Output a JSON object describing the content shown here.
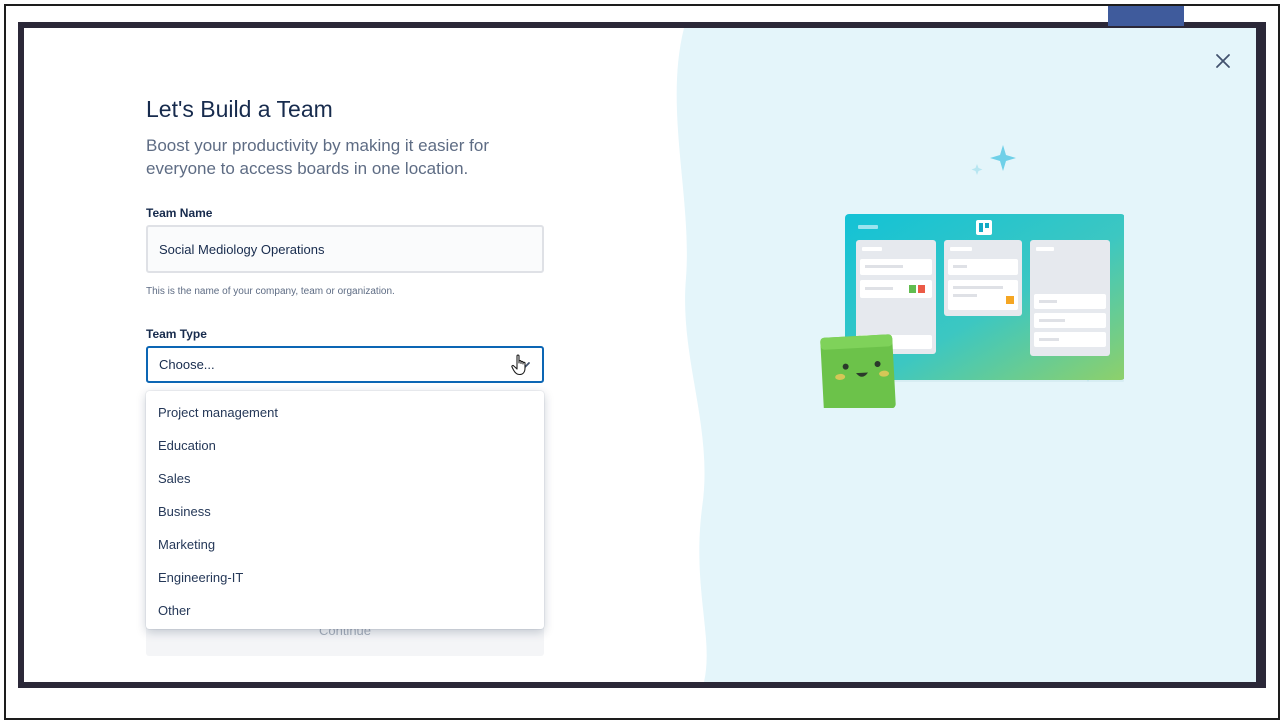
{
  "modal": {
    "title": "Let's Build a Team",
    "subtitle": "Boost your productivity by making it easier for everyone to access boards in one location.",
    "team_name": {
      "label": "Team Name",
      "value": "Social Mediology Operations",
      "helper": "This is the name of your company, team or organization."
    },
    "team_type": {
      "label": "Team Type",
      "value": "Choose...",
      "options": [
        "Project management",
        "Education",
        "Sales",
        "Business",
        "Marketing",
        "Engineering-IT",
        "Other"
      ]
    },
    "continue_label": "Continue"
  },
  "colors": {
    "title": "#172b4d",
    "accent_focus": "#0c66b4",
    "art_background": "#e4f5fa",
    "board_gradient_start": "#13c2d6",
    "board_gradient_end": "#8ed06a",
    "mascot": "#6cc24a"
  },
  "icons": {
    "close": "close-icon",
    "dropdown": "chevron-down-icon",
    "cursor": "hand-cursor-icon",
    "illustration_logo": "trello-logo-icon"
  }
}
